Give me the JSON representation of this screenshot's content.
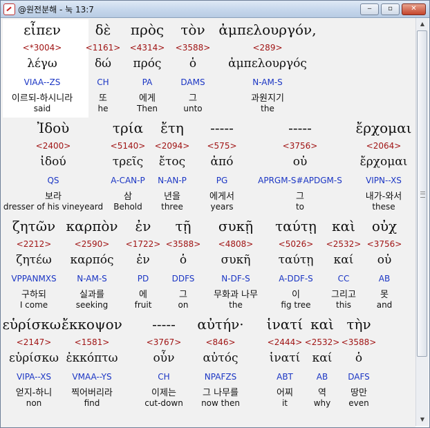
{
  "window": {
    "title": "@원전분해 - 눅 13:7",
    "minimize": "‒",
    "maximize": "▫",
    "close": "✕"
  },
  "rows": [
    {
      "words": [
        {
          "greek": "εἶπεν",
          "strong": "<*3004>",
          "lemma": "λέγω",
          "parse": "VIAA--ZS",
          "korean": "이르되-하시니라",
          "english": "said"
        },
        {
          "greek": "δὲ",
          "strong": "<1161>",
          "lemma": "δώ",
          "parse": "CH",
          "korean": "또",
          "english": "he"
        },
        {
          "greek": "πρὸς",
          "strong": "<4314>",
          "lemma": "πρός",
          "parse": "PA",
          "korean": "에게",
          "english": "Then"
        },
        {
          "greek": "τὸν",
          "strong": "<3588>",
          "lemma": "ὁ",
          "parse": "DAMS",
          "korean": "그",
          "english": "unto"
        },
        {
          "greek": "ἀμπελουργόν,",
          "strong": "<289>",
          "lemma": "ἀμπελουργός",
          "parse": "N-AM-S",
          "korean": "과원지기",
          "english": "the"
        }
      ]
    },
    {
      "words": [
        {
          "greek": "Ἰδοὺ",
          "strong": "<2400>",
          "lemma": "ἰδού",
          "parse": "QS",
          "korean": "보라",
          "english": "dresser of his vineyeard"
        },
        {
          "greek": "τρία",
          "strong": "<5140>",
          "lemma": "τρεῖς",
          "parse": "A-CAN-P",
          "korean": "삼",
          "english": "Behold"
        },
        {
          "greek": "ἔτη",
          "strong": "<2094>",
          "lemma": "ἔτος",
          "parse": "N-AN-P",
          "korean": "년을",
          "english": "three"
        },
        {
          "greek": "-----",
          "strong": "<575>",
          "lemma": "ἀπό",
          "parse": "PG",
          "korean": "에게서",
          "english": "years"
        },
        {
          "greek": "-----",
          "strong": "<3756>",
          "lemma": "οὐ",
          "parse": "APRGM-S#APDGM-S",
          "korean": "그",
          "english": "to"
        },
        {
          "greek": "ἔρχομαι",
          "strong": "<2064>",
          "lemma": "ἔρχομαι",
          "parse": "VIPN--XS",
          "korean": "내가-와서",
          "english": "these"
        }
      ]
    },
    {
      "words": [
        {
          "greek": "ζητῶν",
          "strong": "<2212>",
          "lemma": "ζητέω",
          "parse": "VPPANMXS",
          "korean": "구하되",
          "english": "I come"
        },
        {
          "greek": "καρπὸν",
          "strong": "<2590>",
          "lemma": "καρπός",
          "parse": "N-AM-S",
          "korean": "실과를",
          "english": "seeking"
        },
        {
          "greek": "ἐν",
          "strong": "<1722>",
          "lemma": "ἐν",
          "parse": "PD",
          "korean": "에",
          "english": "fruit"
        },
        {
          "greek": "τῇ",
          "strong": "<3588>",
          "lemma": "ὁ",
          "parse": "DDFS",
          "korean": "그",
          "english": "on"
        },
        {
          "greek": "συκῇ",
          "strong": "<4808>",
          "lemma": "συκῆ",
          "parse": "N-DF-S",
          "korean": "무화과 나무",
          "english": "the"
        },
        {
          "greek": "ταύτῃ",
          "strong": "<5026>",
          "lemma": "ταύτῃ",
          "parse": "A-DDF-S",
          "korean": "이",
          "english": "fig tree"
        },
        {
          "greek": "καὶ",
          "strong": "<2532>",
          "lemma": "καί",
          "parse": "CC",
          "korean": "그리고",
          "english": "this"
        },
        {
          "greek": "οὐχ",
          "strong": "<3756>",
          "lemma": "οὐ",
          "parse": "AB",
          "korean": "못",
          "english": "and"
        }
      ]
    },
    {
      "words": [
        {
          "greek": "εὑρίσκω.",
          "strong": "<2147>",
          "lemma": "εὑρίσκω",
          "parse": "VIPA--XS",
          "korean": "얻지-하니",
          "english": "non"
        },
        {
          "greek": "ἔκκοψον",
          "strong": "<1581>",
          "lemma": "ἐκκόπτω",
          "parse": "VMAA--YS",
          "korean": "찍어버리라",
          "english": "find"
        },
        {
          "greek": "-----",
          "strong": "<3767>",
          "lemma": "οὖν",
          "parse": "CH",
          "korean": "이제는",
          "english": "cut-down"
        },
        {
          "greek": "αὐτήν·",
          "strong": "<846>",
          "lemma": "αὐτός",
          "parse": "NPAFZS",
          "korean": "그 나무를",
          "english": "now then"
        },
        {
          "greek": "ἱνατί",
          "strong": "<2444>",
          "lemma": "ἱνατί",
          "parse": "ABT",
          "korean": "어찌",
          "english": "it"
        },
        {
          "greek": "καὶ",
          "strong": "<2532>",
          "lemma": "καί",
          "parse": "AB",
          "korean": "역",
          "english": "why"
        },
        {
          "greek": "τὴν",
          "strong": "<3588>",
          "lemma": "ὁ",
          "parse": "DAFS",
          "korean": "땅만",
          "english": "even"
        }
      ]
    }
  ]
}
